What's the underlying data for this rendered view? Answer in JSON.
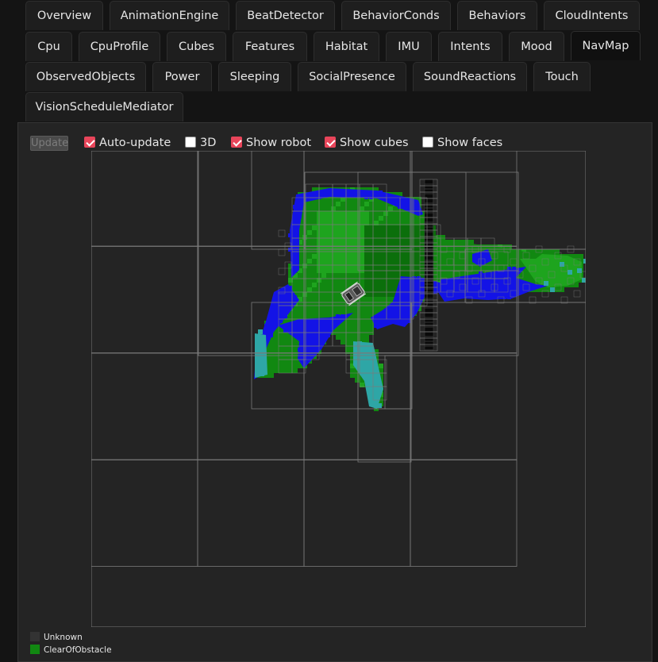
{
  "tabs": [
    {
      "label": "Overview",
      "active": false
    },
    {
      "label": "AnimationEngine",
      "active": false
    },
    {
      "label": "BeatDetector",
      "active": false
    },
    {
      "label": "BehaviorConds",
      "active": false
    },
    {
      "label": "Behaviors",
      "active": false
    },
    {
      "label": "CloudIntents",
      "active": false
    },
    {
      "label": "Cpu",
      "active": false
    },
    {
      "label": "CpuProfile",
      "active": false
    },
    {
      "label": "Cubes",
      "active": false
    },
    {
      "label": "Features",
      "active": false
    },
    {
      "label": "Habitat",
      "active": false
    },
    {
      "label": "IMU",
      "active": false
    },
    {
      "label": "Intents",
      "active": false
    },
    {
      "label": "Mood",
      "active": false
    },
    {
      "label": "NavMap",
      "active": true
    },
    {
      "label": "ObservedObjects",
      "active": false
    },
    {
      "label": "Power",
      "active": false
    },
    {
      "label": "Sleeping",
      "active": false
    },
    {
      "label": "SocialPresence",
      "active": false
    },
    {
      "label": "SoundReactions",
      "active": false
    },
    {
      "label": "Touch",
      "active": false
    },
    {
      "label": "VisionScheduleMediator",
      "active": false
    }
  ],
  "controls": {
    "update_label": "Update",
    "update_enabled": false,
    "checkboxes": [
      {
        "key": "auto_update",
        "label": "Auto-update",
        "checked": true
      },
      {
        "key": "three_d",
        "label": "3D",
        "checked": false
      },
      {
        "key": "show_robot",
        "label": "Show robot",
        "checked": true
      },
      {
        "key": "show_cubes",
        "label": "Show cubes",
        "checked": true
      },
      {
        "key": "show_faces",
        "label": "Show faces",
        "checked": false
      }
    ]
  },
  "map": {
    "colors": {
      "background": "#242424",
      "grid_line": "#7a7a7a",
      "clear": "#118811",
      "clear_dark": "#0b6f0b",
      "clear_light": "#1ea41e",
      "obstacle": "#1313e6",
      "cliff": "#2ea6a6",
      "wall": "#0a0a0a",
      "robot": "#555555"
    }
  },
  "legend": [
    {
      "label": "Unknown",
      "color": "#333333"
    },
    {
      "label": "ClearOfObstacle",
      "color": "#118811"
    }
  ]
}
